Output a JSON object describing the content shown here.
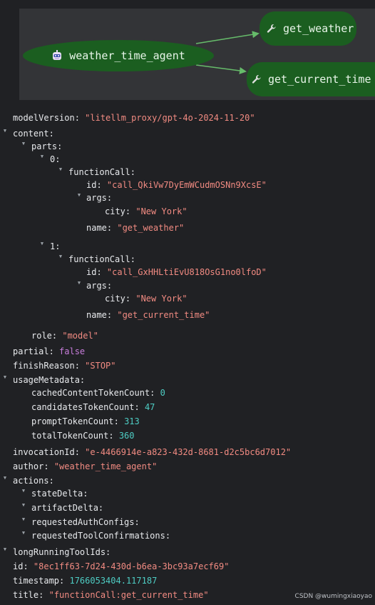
{
  "graph": {
    "agent_label": "weather_time_agent",
    "tool_nodes": [
      "get_weather",
      "get_current_time"
    ],
    "node_color": "#1b5e20",
    "edge_color": "#66bb6a"
  },
  "event": {
    "modelVersion": {
      "key": "modelVersion:",
      "value": "\"litellm_proxy/gpt-4o-2024-11-20\""
    },
    "content": {
      "key": "content:",
      "parts_key": "parts:",
      "parts": [
        {
          "index": "0:",
          "functionCall_key": "functionCall:",
          "id_key": "id:",
          "id": "\"call_QkiVw7DyEmWCudmOSNn9XcsE\"",
          "args_key": "args:",
          "city_key": "city:",
          "city": "\"New York\"",
          "name_key": "name:",
          "name": "\"get_weather\""
        },
        {
          "index": "1:",
          "functionCall_key": "functionCall:",
          "id_key": "id:",
          "id": "\"call_GxHHLtiEvU818OsG1no0lfoD\"",
          "args_key": "args:",
          "city_key": "city:",
          "city": "\"New York\"",
          "name_key": "name:",
          "name": "\"get_current_time\""
        }
      ],
      "role_key": "role:",
      "role": "\"model\""
    },
    "partial": {
      "key": "partial:",
      "value": "false"
    },
    "finishReason": {
      "key": "finishReason:",
      "value": "\"STOP\""
    },
    "usageMetadata": {
      "key": "usageMetadata:",
      "cached_key": "cachedContentTokenCount:",
      "cached": "0",
      "candidates_key": "candidatesTokenCount:",
      "candidates": "47",
      "prompt_key": "promptTokenCount:",
      "prompt": "313",
      "total_key": "totalTokenCount:",
      "total": "360"
    },
    "invocationId": {
      "key": "invocationId:",
      "value": "\"e-4466914e-a823-432d-8681-d2c5bc6d7012\""
    },
    "author": {
      "key": "author:",
      "value": "\"weather_time_agent\""
    },
    "actions": {
      "key": "actions:",
      "items": [
        "stateDelta:",
        "artifactDelta:",
        "requestedAuthConfigs:",
        "requestedToolConfirmations:"
      ]
    },
    "longRunningToolIds": {
      "key": "longRunningToolIds:"
    },
    "id": {
      "key": "id:",
      "value": "\"8ec1ff63-7d24-430d-b6ea-3bc93a7ecf69\""
    },
    "timestamp": {
      "key": "timestamp:",
      "value": "1766053404.117187"
    },
    "title": {
      "key": "title:",
      "value": "\"functionCall:get_current_time\""
    }
  },
  "watermark": "CSDN @wumingxiaoyao"
}
